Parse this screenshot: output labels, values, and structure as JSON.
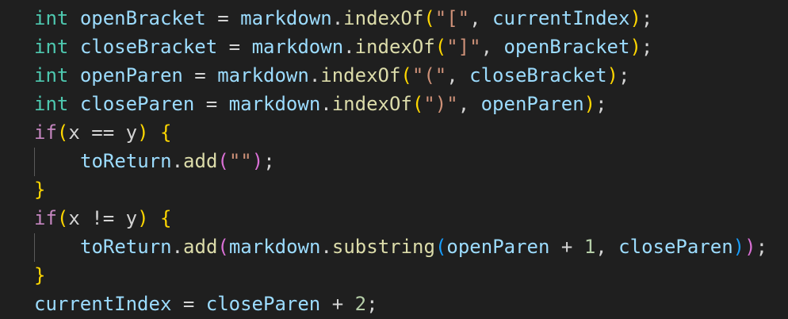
{
  "colors": {
    "background": "#1f1f1f",
    "type_keyword": "#4ec9b0",
    "control_keyword": "#c586c0",
    "variable": "#9cdcfe",
    "function": "#dcdcaa",
    "string": "#ce9178",
    "number": "#b5cea8",
    "bracket_1": "#ffd700",
    "bracket_2": "#da70d6",
    "bracket_3": "#179fff"
  },
  "code": {
    "l1": {
      "kw": "int",
      "var": "openBracket",
      "eq": " = ",
      "obj": "markdown",
      "dot": ".",
      "fn": "indexOf",
      "po": "(",
      "str": "\"[\"",
      "comma": ", ",
      "arg": "currentIndex",
      "pc": ")",
      "semi": ";"
    },
    "l2": {
      "kw": "int",
      "var": "closeBracket",
      "eq": " = ",
      "obj": "markdown",
      "dot": ".",
      "fn": "indexOf",
      "po": "(",
      "str": "\"]\"",
      "comma": ", ",
      "arg": "openBracket",
      "pc": ")",
      "semi": ";"
    },
    "l3": {
      "kw": "int",
      "var": "openParen",
      "eq": " = ",
      "obj": "markdown",
      "dot": ".",
      "fn": "indexOf",
      "po": "(",
      "str": "\"(\"",
      "comma": ", ",
      "arg": "closeBracket",
      "pc": ")",
      "semi": ";"
    },
    "l4": {
      "kw": "int",
      "var": "closeParen",
      "eq": " = ",
      "obj": "markdown",
      "dot": ".",
      "fn": "indexOf",
      "po": "(",
      "str": "\")\"",
      "comma": ", ",
      "arg": "openParen",
      "pc": ")",
      "semi": ";"
    },
    "l5": {
      "kw": "if",
      "po": "(",
      "a": "x",
      "op": " == ",
      "b": "y",
      "pc": ")",
      "sp": " ",
      "brace": "{"
    },
    "l6": {
      "obj": "toReturn",
      "dot": ".",
      "fn": "add",
      "po": "(",
      "str": "\"\"",
      "pc": ")",
      "semi": ";"
    },
    "l7": {
      "brace": "}"
    },
    "l8": {
      "kw": "if",
      "po": "(",
      "a": "x",
      "op": " != ",
      "b": "y",
      "pc": ")",
      "sp": " ",
      "brace": "{"
    },
    "l9": {
      "obj": "toReturn",
      "dot": ".",
      "fn": "add",
      "po": "(",
      "obj2": "markdown",
      "dot2": ".",
      "fn2": "substring",
      "po2": "(",
      "arg1": "openParen",
      "plus": " + ",
      "num": "1",
      "comma": ", ",
      "arg2": "closeParen",
      "pc2": ")",
      "pc": ")",
      "semi": ";"
    },
    "l10": {
      "brace": "}"
    },
    "l11": {
      "var": "currentIndex",
      "eq": " = ",
      "arg": "closeParen",
      "plus": " + ",
      "num": "2",
      "semi": ";"
    }
  }
}
